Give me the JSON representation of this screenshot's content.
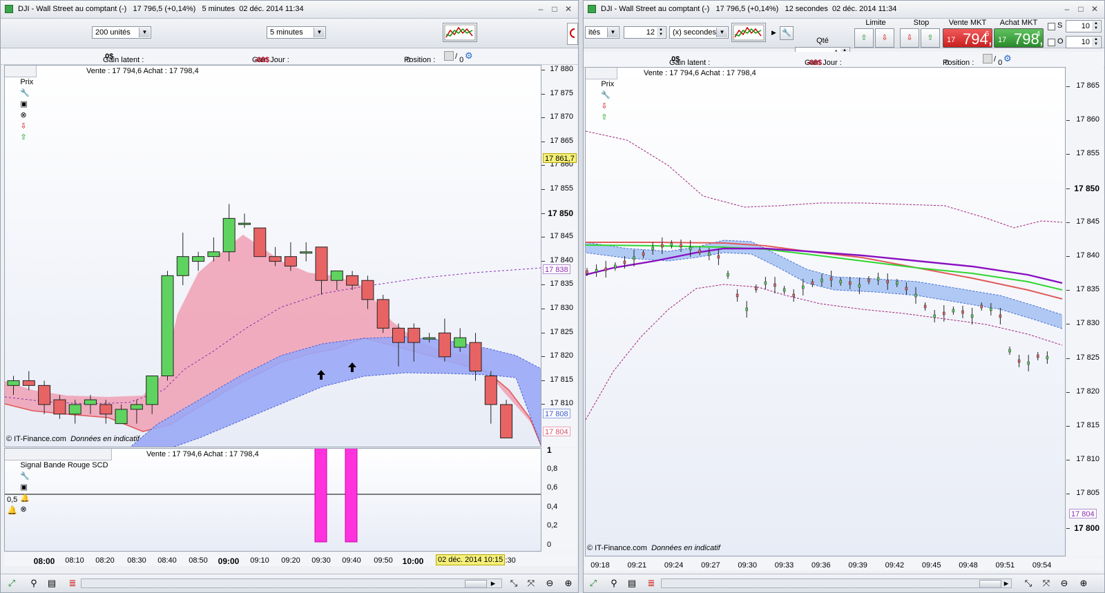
{
  "left": {
    "title": "DJI - Wall Street au comptant (-)   17 796,5 (+0,14%)   5 minutes  02 déc. 2014 11:34",
    "units_select": "200 unités",
    "interval_select": "5 minutes",
    "gain_latent_label": "Gain latent :",
    "gain_latent_value": "0$",
    "gain_jour_label": "Gain Jour :",
    "gain_jour_value": "-68$",
    "position_label": "Position :",
    "position_value": "0",
    "position_value2": "0",
    "price_tag": "Prix",
    "quote": "Vente : 17 794,6 Achat : 17 798,4",
    "credit": "© IT-Finance.com",
    "credit_note": "Données en indicatif",
    "indicator_tag": "Signal Bande Rouge SCD",
    "indicator_quote": "Vente : 17 794,6 Achat : 17 798,4",
    "indicator_level": "0,5",
    "y_ticks": [
      "17 880",
      "17 875",
      "17 870",
      "17 865",
      "17 860",
      "17 855",
      "17 850",
      "17 845",
      "17 840",
      "17 835",
      "17 830",
      "17 825",
      "17 820",
      "17 815",
      "17 810"
    ],
    "badges": [
      {
        "text": "17 861,7",
        "bg": "#f5f07a",
        "fg": "#000",
        "border": "#b8a800"
      },
      {
        "text": "17 838",
        "bg": "#ffffff",
        "fg": "#8a2bb0",
        "border": "#b58ad0"
      },
      {
        "text": "17 808",
        "bg": "#ffffff",
        "fg": "#3a56c8",
        "border": "#8aa0e0"
      },
      {
        "text": "17 804",
        "bg": "#ffffff",
        "fg": "#d0506a",
        "border": "#e8a0b0"
      }
    ],
    "ind_ticks": [
      "1",
      "0,8",
      "0,6",
      "0,4",
      "0,2",
      "0"
    ],
    "x_ticks": [
      "08:00",
      "08:10",
      "08:20",
      "08:30",
      "08:40",
      "08:50",
      "09:00",
      "09:10",
      "09:20",
      "09:30",
      "09:40",
      "09:50",
      "10:00",
      "10:30"
    ],
    "x_highlight": "02 déc. 2014 10:15",
    "colors": {
      "up": "#5fd35f",
      "down": "#e86464",
      "band_red": "#f0a0b4",
      "band_blue": "#9aa8f6",
      "signal": "#ff33dd"
    }
  },
  "right": {
    "title": "DJI - Wall Street au comptant (-)   17 796,5 (+0,14%)   12 secondes  02 déc. 2014 11:34",
    "units_select": "ités",
    "interval_value": "12",
    "interval_select": "(x) secondes",
    "qty_label": "Qté",
    "qty_value": "1",
    "limit_label": "Limite",
    "stop_label": "Stop",
    "sell_label": "Vente MKT",
    "buy_label": "Achat MKT",
    "sell_prefix": "17",
    "sell_main": "794,",
    "sell_sup": "6",
    "buy_prefix": "17",
    "buy_main": "798,",
    "buy_sup": "4",
    "s_label": "S",
    "o_label": "O",
    "s_value": "10",
    "o_value": "10",
    "gain_latent_label": "Gain latent :",
    "gain_latent_value": "0$",
    "gain_jour_label": "Gain Jour :",
    "gain_jour_value": "-68$",
    "position_label": "Position :",
    "position_value": "0",
    "position_value2": "0",
    "price_tag": "Prix",
    "quote": "Vente : 17 794,6 Achat : 17 798,4",
    "credit": "© IT-Finance.com",
    "credit_note": "Données en indicatif",
    "y_ticks": [
      "17 865",
      "17 860",
      "17 855",
      "17 850",
      "17 845",
      "17 840",
      "17 835",
      "17 830",
      "17 825",
      "17 820",
      "17 815",
      "17 810",
      "17 805",
      "17 800"
    ],
    "badge": "17 804",
    "x_ticks": [
      "09:18",
      "09:21",
      "09:24",
      "09:27",
      "09:30",
      "09:33",
      "09:36",
      "09:39",
      "09:42",
      "09:45",
      "09:48",
      "09:51",
      "09:54"
    ]
  }
}
